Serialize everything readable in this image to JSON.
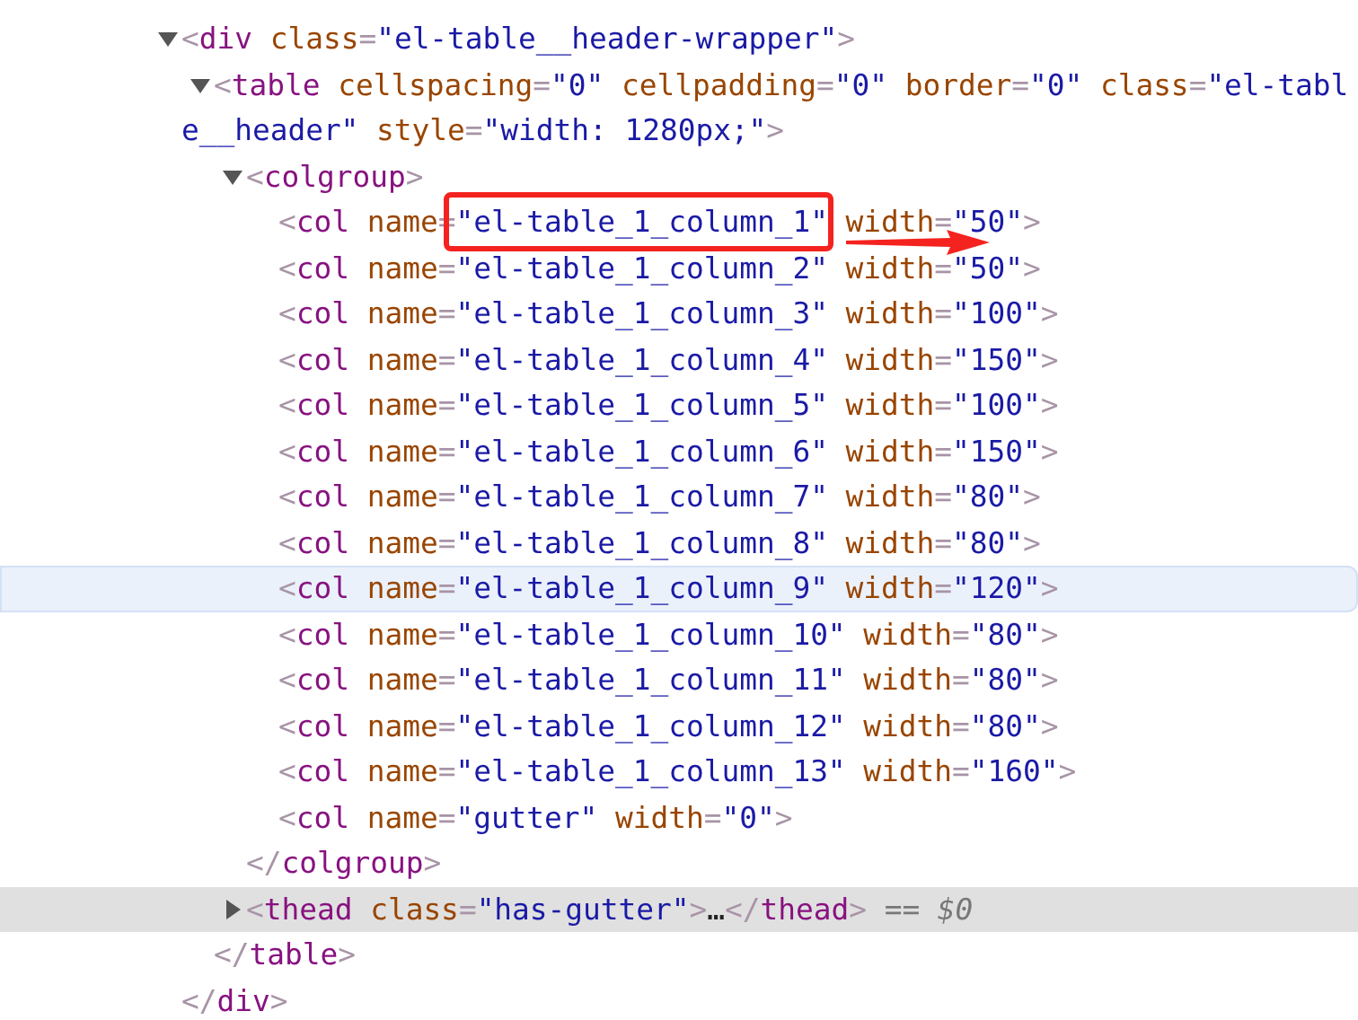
{
  "elements_panel": {
    "nodes": [
      {
        "expanded": true,
        "open": [
          {
            "kind": "punct",
            "t": "<"
          },
          {
            "kind": "tag",
            "t": "div"
          },
          {
            "kind": "attr",
            "t": " class"
          },
          {
            "kind": "punct",
            "t": "="
          },
          {
            "kind": "value",
            "t": "\"el-table__header-wrapper\""
          },
          {
            "kind": "punct",
            "t": ">"
          }
        ],
        "children": [
          {
            "expanded": true,
            "open": [
              {
                "kind": "punct",
                "t": "<"
              },
              {
                "kind": "tag",
                "t": "table"
              },
              {
                "kind": "attr",
                "t": " cellspacing"
              },
              {
                "kind": "punct",
                "t": "="
              },
              {
                "kind": "value",
                "t": "\"0\""
              },
              {
                "kind": "attr",
                "t": " cellpadding"
              },
              {
                "kind": "punct",
                "t": "="
              },
              {
                "kind": "value",
                "t": "\"0\""
              },
              {
                "kind": "attr",
                "t": " border"
              },
              {
                "kind": "punct",
                "t": "="
              },
              {
                "kind": "value",
                "t": "\"0\""
              },
              {
                "kind": "attr",
                "t": " class"
              },
              {
                "kind": "punct",
                "t": "="
              },
              {
                "kind": "value",
                "t": "\"el-table__header\""
              },
              {
                "kind": "attr",
                "t": " style"
              },
              {
                "kind": "punct",
                "t": "="
              },
              {
                "kind": "value",
                "t": "\"width: 1280px;\""
              },
              {
                "kind": "punct",
                "t": ">"
              }
            ],
            "children": [
              {
                "expanded": true,
                "open": [
                  {
                    "kind": "punct",
                    "t": "<"
                  },
                  {
                    "kind": "tag",
                    "t": "colgroup"
                  },
                  {
                    "kind": "punct",
                    "t": ">"
                  }
                ],
                "children": [
                  {
                    "open": [
                      {
                        "kind": "punct",
                        "t": "<"
                      },
                      {
                        "kind": "tag",
                        "t": "col"
                      },
                      {
                        "kind": "attr",
                        "t": " name"
                      },
                      {
                        "kind": "punct",
                        "t": "="
                      },
                      {
                        "kind": "value",
                        "t": "\"el-table_1_column_1\"",
                        "marked": true
                      },
                      {
                        "kind": "attr",
                        "t": " width"
                      },
                      {
                        "kind": "punct",
                        "t": "="
                      },
                      {
                        "kind": "value",
                        "t": "\"50\""
                      },
                      {
                        "kind": "punct",
                        "t": ">"
                      }
                    ]
                  },
                  {
                    "open": [
                      {
                        "kind": "punct",
                        "t": "<"
                      },
                      {
                        "kind": "tag",
                        "t": "col"
                      },
                      {
                        "kind": "attr",
                        "t": " name"
                      },
                      {
                        "kind": "punct",
                        "t": "="
                      },
                      {
                        "kind": "value",
                        "t": "\"el-table_1_column_2\""
                      },
                      {
                        "kind": "attr",
                        "t": " width"
                      },
                      {
                        "kind": "punct",
                        "t": "="
                      },
                      {
                        "kind": "value",
                        "t": "\"50\""
                      },
                      {
                        "kind": "punct",
                        "t": ">"
                      }
                    ]
                  },
                  {
                    "open": [
                      {
                        "kind": "punct",
                        "t": "<"
                      },
                      {
                        "kind": "tag",
                        "t": "col"
                      },
                      {
                        "kind": "attr",
                        "t": " name"
                      },
                      {
                        "kind": "punct",
                        "t": "="
                      },
                      {
                        "kind": "value",
                        "t": "\"el-table_1_column_3\""
                      },
                      {
                        "kind": "attr",
                        "t": " width"
                      },
                      {
                        "kind": "punct",
                        "t": "="
                      },
                      {
                        "kind": "value",
                        "t": "\"100\""
                      },
                      {
                        "kind": "punct",
                        "t": ">"
                      }
                    ]
                  },
                  {
                    "open": [
                      {
                        "kind": "punct",
                        "t": "<"
                      },
                      {
                        "kind": "tag",
                        "t": "col"
                      },
                      {
                        "kind": "attr",
                        "t": " name"
                      },
                      {
                        "kind": "punct",
                        "t": "="
                      },
                      {
                        "kind": "value",
                        "t": "\"el-table_1_column_4\""
                      },
                      {
                        "kind": "attr",
                        "t": " width"
                      },
                      {
                        "kind": "punct",
                        "t": "="
                      },
                      {
                        "kind": "value",
                        "t": "\"150\""
                      },
                      {
                        "kind": "punct",
                        "t": ">"
                      }
                    ]
                  },
                  {
                    "open": [
                      {
                        "kind": "punct",
                        "t": "<"
                      },
                      {
                        "kind": "tag",
                        "t": "col"
                      },
                      {
                        "kind": "attr",
                        "t": " name"
                      },
                      {
                        "kind": "punct",
                        "t": "="
                      },
                      {
                        "kind": "value",
                        "t": "\"el-table_1_column_5\""
                      },
                      {
                        "kind": "attr",
                        "t": " width"
                      },
                      {
                        "kind": "punct",
                        "t": "="
                      },
                      {
                        "kind": "value",
                        "t": "\"100\""
                      },
                      {
                        "kind": "punct",
                        "t": ">"
                      }
                    ]
                  },
                  {
                    "open": [
                      {
                        "kind": "punct",
                        "t": "<"
                      },
                      {
                        "kind": "tag",
                        "t": "col"
                      },
                      {
                        "kind": "attr",
                        "t": " name"
                      },
                      {
                        "kind": "punct",
                        "t": "="
                      },
                      {
                        "kind": "value",
                        "t": "\"el-table_1_column_6\""
                      },
                      {
                        "kind": "attr",
                        "t": " width"
                      },
                      {
                        "kind": "punct",
                        "t": "="
                      },
                      {
                        "kind": "value",
                        "t": "\"150\""
                      },
                      {
                        "kind": "punct",
                        "t": ">"
                      }
                    ]
                  },
                  {
                    "open": [
                      {
                        "kind": "punct",
                        "t": "<"
                      },
                      {
                        "kind": "tag",
                        "t": "col"
                      },
                      {
                        "kind": "attr",
                        "t": " name"
                      },
                      {
                        "kind": "punct",
                        "t": "="
                      },
                      {
                        "kind": "value",
                        "t": "\"el-table_1_column_7\""
                      },
                      {
                        "kind": "attr",
                        "t": " width"
                      },
                      {
                        "kind": "punct",
                        "t": "="
                      },
                      {
                        "kind": "value",
                        "t": "\"80\""
                      },
                      {
                        "kind": "punct",
                        "t": ">"
                      }
                    ]
                  },
                  {
                    "open": [
                      {
                        "kind": "punct",
                        "t": "<"
                      },
                      {
                        "kind": "tag",
                        "t": "col"
                      },
                      {
                        "kind": "attr",
                        "t": " name"
                      },
                      {
                        "kind": "punct",
                        "t": "="
                      },
                      {
                        "kind": "value",
                        "t": "\"el-table_1_column_8\""
                      },
                      {
                        "kind": "attr",
                        "t": " width"
                      },
                      {
                        "kind": "punct",
                        "t": "="
                      },
                      {
                        "kind": "value",
                        "t": "\"80\""
                      },
                      {
                        "kind": "punct",
                        "t": ">"
                      }
                    ]
                  },
                  {
                    "hovered": true,
                    "open": [
                      {
                        "kind": "punct",
                        "t": "<"
                      },
                      {
                        "kind": "tag",
                        "t": "col"
                      },
                      {
                        "kind": "attr",
                        "t": " name"
                      },
                      {
                        "kind": "punct",
                        "t": "="
                      },
                      {
                        "kind": "value",
                        "t": "\"el-table_1_column_9\""
                      },
                      {
                        "kind": "attr",
                        "t": " width"
                      },
                      {
                        "kind": "punct",
                        "t": "="
                      },
                      {
                        "kind": "value",
                        "t": "\"120\""
                      },
                      {
                        "kind": "punct",
                        "t": ">"
                      }
                    ]
                  },
                  {
                    "open": [
                      {
                        "kind": "punct",
                        "t": "<"
                      },
                      {
                        "kind": "tag",
                        "t": "col"
                      },
                      {
                        "kind": "attr",
                        "t": " name"
                      },
                      {
                        "kind": "punct",
                        "t": "="
                      },
                      {
                        "kind": "value",
                        "t": "\"el-table_1_column_10\""
                      },
                      {
                        "kind": "attr",
                        "t": " width"
                      },
                      {
                        "kind": "punct",
                        "t": "="
                      },
                      {
                        "kind": "value",
                        "t": "\"80\""
                      },
                      {
                        "kind": "punct",
                        "t": ">"
                      }
                    ]
                  },
                  {
                    "open": [
                      {
                        "kind": "punct",
                        "t": "<"
                      },
                      {
                        "kind": "tag",
                        "t": "col"
                      },
                      {
                        "kind": "attr",
                        "t": " name"
                      },
                      {
                        "kind": "punct",
                        "t": "="
                      },
                      {
                        "kind": "value",
                        "t": "\"el-table_1_column_11\""
                      },
                      {
                        "kind": "attr",
                        "t": " width"
                      },
                      {
                        "kind": "punct",
                        "t": "="
                      },
                      {
                        "kind": "value",
                        "t": "\"80\""
                      },
                      {
                        "kind": "punct",
                        "t": ">"
                      }
                    ]
                  },
                  {
                    "open": [
                      {
                        "kind": "punct",
                        "t": "<"
                      },
                      {
                        "kind": "tag",
                        "t": "col"
                      },
                      {
                        "kind": "attr",
                        "t": " name"
                      },
                      {
                        "kind": "punct",
                        "t": "="
                      },
                      {
                        "kind": "value",
                        "t": "\"el-table_1_column_12\""
                      },
                      {
                        "kind": "attr",
                        "t": " width"
                      },
                      {
                        "kind": "punct",
                        "t": "="
                      },
                      {
                        "kind": "value",
                        "t": "\"80\""
                      },
                      {
                        "kind": "punct",
                        "t": ">"
                      }
                    ]
                  },
                  {
                    "open": [
                      {
                        "kind": "punct",
                        "t": "<"
                      },
                      {
                        "kind": "tag",
                        "t": "col"
                      },
                      {
                        "kind": "attr",
                        "t": " name"
                      },
                      {
                        "kind": "punct",
                        "t": "="
                      },
                      {
                        "kind": "value",
                        "t": "\"el-table_1_column_13\""
                      },
                      {
                        "kind": "attr",
                        "t": " width"
                      },
                      {
                        "kind": "punct",
                        "t": "="
                      },
                      {
                        "kind": "value",
                        "t": "\"160\""
                      },
                      {
                        "kind": "punct",
                        "t": ">"
                      }
                    ]
                  },
                  {
                    "open": [
                      {
                        "kind": "punct",
                        "t": "<"
                      },
                      {
                        "kind": "tag",
                        "t": "col"
                      },
                      {
                        "kind": "attr",
                        "t": " name"
                      },
                      {
                        "kind": "punct",
                        "t": "="
                      },
                      {
                        "kind": "value",
                        "t": "\"gutter\""
                      },
                      {
                        "kind": "attr",
                        "t": " width"
                      },
                      {
                        "kind": "punct",
                        "t": "="
                      },
                      {
                        "kind": "value",
                        "t": "\"0\""
                      },
                      {
                        "kind": "punct",
                        "t": ">"
                      }
                    ]
                  }
                ],
                "close": [
                  {
                    "kind": "punct",
                    "t": "</"
                  },
                  {
                    "kind": "tag",
                    "t": "colgroup"
                  },
                  {
                    "kind": "punct",
                    "t": ">"
                  }
                ]
              },
              {
                "expanded": false,
                "selected": true,
                "open": [
                  {
                    "kind": "punct",
                    "t": "<"
                  },
                  {
                    "kind": "tag",
                    "t": "thead"
                  },
                  {
                    "kind": "attr",
                    "t": " class"
                  },
                  {
                    "kind": "punct",
                    "t": "="
                  },
                  {
                    "kind": "value",
                    "t": "\"has-gutter\""
                  },
                  {
                    "kind": "punct",
                    "t": ">"
                  },
                  {
                    "kind": "text",
                    "t": "…"
                  },
                  {
                    "kind": "punct",
                    "t": "</"
                  },
                  {
                    "kind": "tag",
                    "t": "thead"
                  },
                  {
                    "kind": "punct",
                    "t": ">"
                  },
                  {
                    "kind": "ref",
                    "t": " == $0"
                  }
                ]
              }
            ],
            "close": [
              {
                "kind": "punct",
                "t": "</"
              },
              {
                "kind": "tag",
                "t": "table"
              },
              {
                "kind": "punct",
                "t": ">"
              }
            ]
          }
        ],
        "close": [
          {
            "kind": "punct",
            "t": "</"
          },
          {
            "kind": "tag",
            "t": "div"
          },
          {
            "kind": "punct",
            "t": ">"
          }
        ]
      }
    ]
  }
}
